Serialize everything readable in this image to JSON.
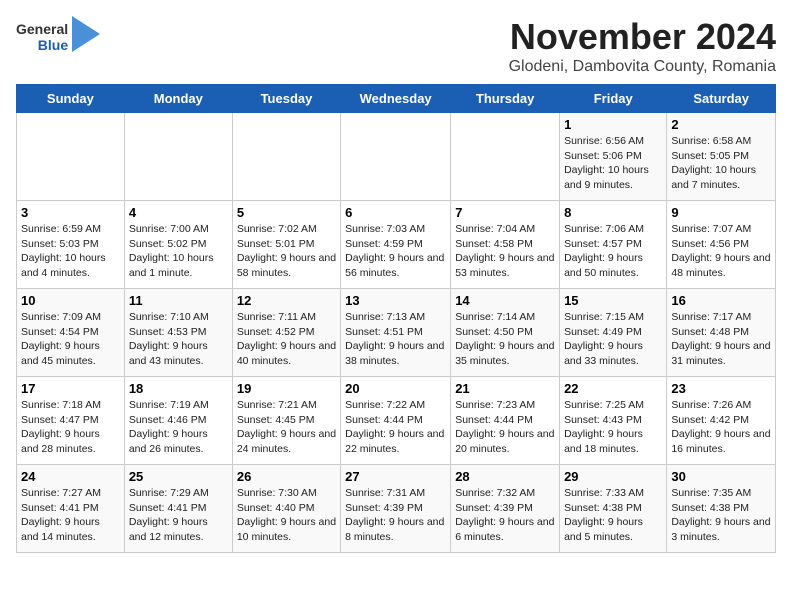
{
  "logo": {
    "general": "General",
    "blue": "Blue"
  },
  "title": "November 2024",
  "subtitle": "Glodeni, Dambovita County, Romania",
  "headers": [
    "Sunday",
    "Monday",
    "Tuesday",
    "Wednesday",
    "Thursday",
    "Friday",
    "Saturday"
  ],
  "weeks": [
    [
      {
        "day": "",
        "info": ""
      },
      {
        "day": "",
        "info": ""
      },
      {
        "day": "",
        "info": ""
      },
      {
        "day": "",
        "info": ""
      },
      {
        "day": "",
        "info": ""
      },
      {
        "day": "1",
        "info": "Sunrise: 6:56 AM\nSunset: 5:06 PM\nDaylight: 10 hours and 9 minutes."
      },
      {
        "day": "2",
        "info": "Sunrise: 6:58 AM\nSunset: 5:05 PM\nDaylight: 10 hours and 7 minutes."
      }
    ],
    [
      {
        "day": "3",
        "info": "Sunrise: 6:59 AM\nSunset: 5:03 PM\nDaylight: 10 hours and 4 minutes."
      },
      {
        "day": "4",
        "info": "Sunrise: 7:00 AM\nSunset: 5:02 PM\nDaylight: 10 hours and 1 minute."
      },
      {
        "day": "5",
        "info": "Sunrise: 7:02 AM\nSunset: 5:01 PM\nDaylight: 9 hours and 58 minutes."
      },
      {
        "day": "6",
        "info": "Sunrise: 7:03 AM\nSunset: 4:59 PM\nDaylight: 9 hours and 56 minutes."
      },
      {
        "day": "7",
        "info": "Sunrise: 7:04 AM\nSunset: 4:58 PM\nDaylight: 9 hours and 53 minutes."
      },
      {
        "day": "8",
        "info": "Sunrise: 7:06 AM\nSunset: 4:57 PM\nDaylight: 9 hours and 50 minutes."
      },
      {
        "day": "9",
        "info": "Sunrise: 7:07 AM\nSunset: 4:56 PM\nDaylight: 9 hours and 48 minutes."
      }
    ],
    [
      {
        "day": "10",
        "info": "Sunrise: 7:09 AM\nSunset: 4:54 PM\nDaylight: 9 hours and 45 minutes."
      },
      {
        "day": "11",
        "info": "Sunrise: 7:10 AM\nSunset: 4:53 PM\nDaylight: 9 hours and 43 minutes."
      },
      {
        "day": "12",
        "info": "Sunrise: 7:11 AM\nSunset: 4:52 PM\nDaylight: 9 hours and 40 minutes."
      },
      {
        "day": "13",
        "info": "Sunrise: 7:13 AM\nSunset: 4:51 PM\nDaylight: 9 hours and 38 minutes."
      },
      {
        "day": "14",
        "info": "Sunrise: 7:14 AM\nSunset: 4:50 PM\nDaylight: 9 hours and 35 minutes."
      },
      {
        "day": "15",
        "info": "Sunrise: 7:15 AM\nSunset: 4:49 PM\nDaylight: 9 hours and 33 minutes."
      },
      {
        "day": "16",
        "info": "Sunrise: 7:17 AM\nSunset: 4:48 PM\nDaylight: 9 hours and 31 minutes."
      }
    ],
    [
      {
        "day": "17",
        "info": "Sunrise: 7:18 AM\nSunset: 4:47 PM\nDaylight: 9 hours and 28 minutes."
      },
      {
        "day": "18",
        "info": "Sunrise: 7:19 AM\nSunset: 4:46 PM\nDaylight: 9 hours and 26 minutes."
      },
      {
        "day": "19",
        "info": "Sunrise: 7:21 AM\nSunset: 4:45 PM\nDaylight: 9 hours and 24 minutes."
      },
      {
        "day": "20",
        "info": "Sunrise: 7:22 AM\nSunset: 4:44 PM\nDaylight: 9 hours and 22 minutes."
      },
      {
        "day": "21",
        "info": "Sunrise: 7:23 AM\nSunset: 4:44 PM\nDaylight: 9 hours and 20 minutes."
      },
      {
        "day": "22",
        "info": "Sunrise: 7:25 AM\nSunset: 4:43 PM\nDaylight: 9 hours and 18 minutes."
      },
      {
        "day": "23",
        "info": "Sunrise: 7:26 AM\nSunset: 4:42 PM\nDaylight: 9 hours and 16 minutes."
      }
    ],
    [
      {
        "day": "24",
        "info": "Sunrise: 7:27 AM\nSunset: 4:41 PM\nDaylight: 9 hours and 14 minutes."
      },
      {
        "day": "25",
        "info": "Sunrise: 7:29 AM\nSunset: 4:41 PM\nDaylight: 9 hours and 12 minutes."
      },
      {
        "day": "26",
        "info": "Sunrise: 7:30 AM\nSunset: 4:40 PM\nDaylight: 9 hours and 10 minutes."
      },
      {
        "day": "27",
        "info": "Sunrise: 7:31 AM\nSunset: 4:39 PM\nDaylight: 9 hours and 8 minutes."
      },
      {
        "day": "28",
        "info": "Sunrise: 7:32 AM\nSunset: 4:39 PM\nDaylight: 9 hours and 6 minutes."
      },
      {
        "day": "29",
        "info": "Sunrise: 7:33 AM\nSunset: 4:38 PM\nDaylight: 9 hours and 5 minutes."
      },
      {
        "day": "30",
        "info": "Sunrise: 7:35 AM\nSunset: 4:38 PM\nDaylight: 9 hours and 3 minutes."
      }
    ]
  ]
}
